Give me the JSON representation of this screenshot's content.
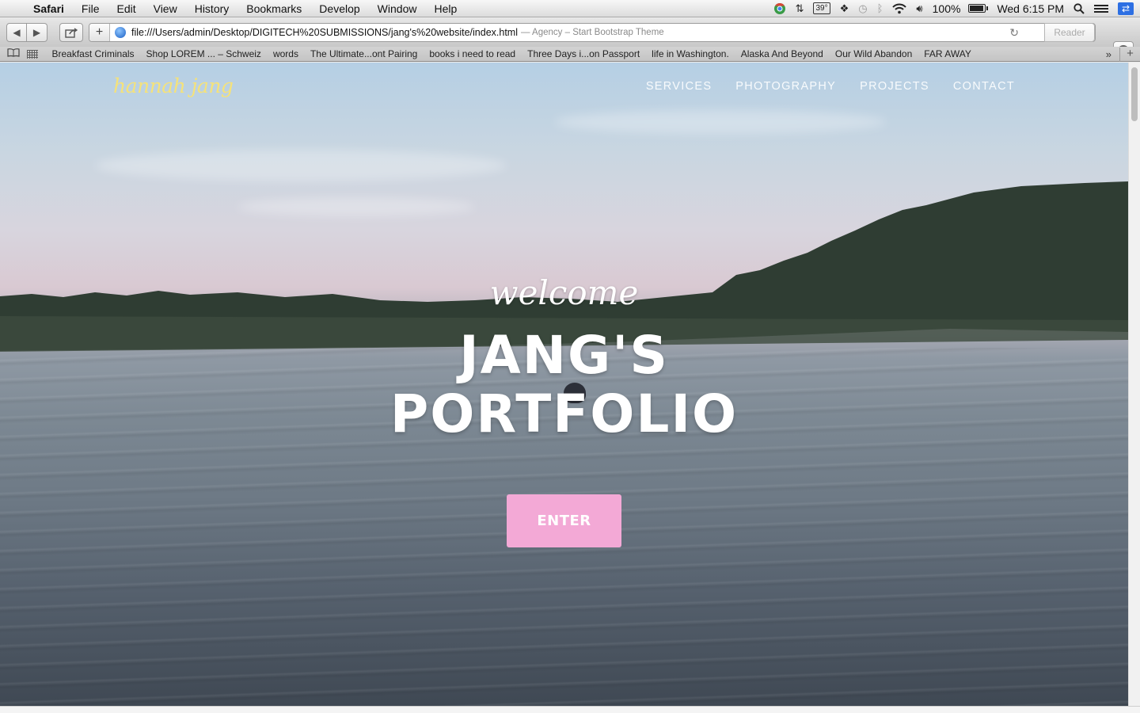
{
  "menubar": {
    "app_name": "Safari",
    "menus": [
      "File",
      "Edit",
      "View",
      "History",
      "Bookmarks",
      "Develop",
      "Window",
      "Help"
    ],
    "temperature": "39°",
    "battery_text": "100%",
    "battery_level": 1.0,
    "clock": "Wed 6:15 PM"
  },
  "browser": {
    "url": "file:///Users/admin/Desktop/DIGITECH%20SUBMISSIONS/jang's%20website/index.html",
    "page_title": "— Agency – Start Bootstrap Theme",
    "reader_label": "Reader"
  },
  "bookmarks": [
    "Breakfast Criminals",
    "Shop LOREM ... – Schweiz",
    "words",
    "The Ultimate...ont Pairing",
    "books i need to read",
    "Three Days i...on Passport",
    "life in Washington.",
    "Alaska And Beyond",
    "Our Wild Abandon",
    "FAR AWAY"
  ],
  "site": {
    "brand": "hannah jang",
    "nav": [
      "SERVICES",
      "PHOTOGRAPHY",
      "PROJECTS",
      "CONTACT"
    ],
    "welcome": "welcome",
    "headline_line1": "JANG'S",
    "headline_line2": "PORTFOLIO",
    "enter_label": "ENTER",
    "enter_color": "#f3a9d6",
    "brand_color": "#f5e27a"
  }
}
